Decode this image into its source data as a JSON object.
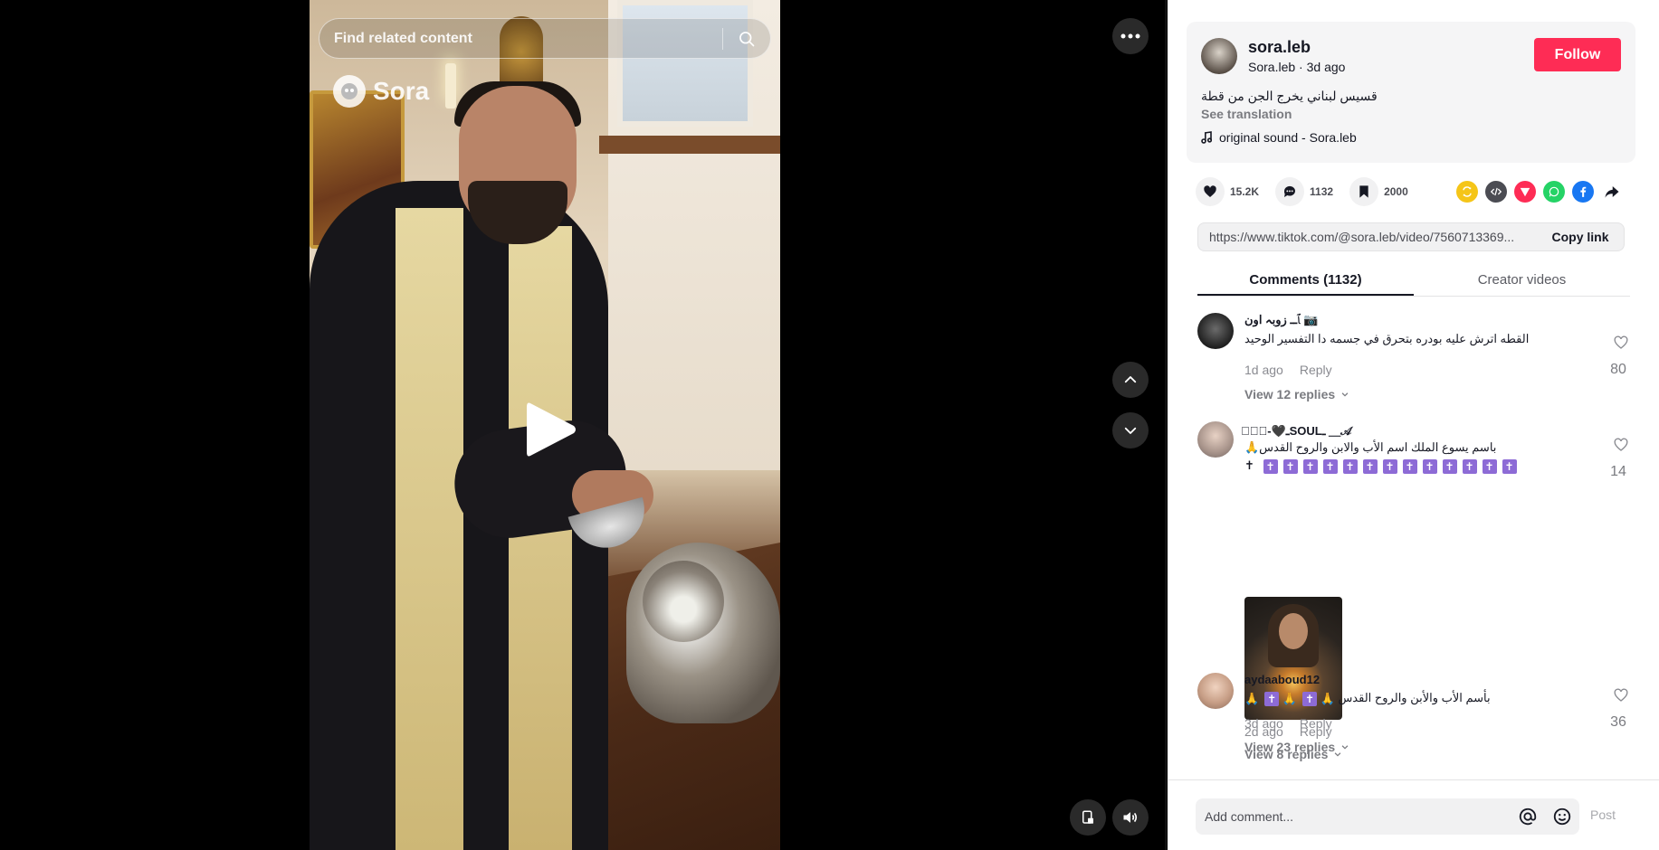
{
  "search": {
    "placeholder": "Find related content"
  },
  "watermark": {
    "text": "Sora"
  },
  "author": {
    "username": "sora.leb",
    "display_name": "Sora.leb",
    "time_ago": "3d ago",
    "follow_label": "Follow"
  },
  "post": {
    "caption": "قسيس لبناني يخرج الجن من قطة",
    "see_translation": "See translation",
    "sound": "original sound - Sora.leb"
  },
  "stats": {
    "likes": "15.2K",
    "comments": "1132",
    "saves": "2000"
  },
  "share_icons": [
    "repost-icon",
    "embed-icon",
    "send-icon",
    "whatsapp-icon",
    "facebook-icon",
    "share-arrow-icon"
  ],
  "link": {
    "url": "https://www.tiktok.com/@sora.leb/video/7560713369...",
    "copy_label": "Copy link"
  },
  "tabs": [
    {
      "label": "Comments (1132)",
      "active": true
    },
    {
      "label": "Creator videos",
      "active": false
    }
  ],
  "comments": [
    {
      "name": "ﭑــ زوبہ اون 📷",
      "text": "القطه اترش عليه بودره بتحرق في جسمه دا التفسير الوحيد",
      "time": "1d ago",
      "reply": "Reply",
      "likes": "80",
      "view_replies": "View 12 replies"
    },
    {
      "name": "͏𝚇𝚇꙰-🖤ـSOULـ ＿𝒜",
      "text": "باسم يسوع الملك اسم الأب والابن والروح القدس🙏",
      "text2": "✝",
      "cross_count": 13,
      "time": "2d ago",
      "reply": "Reply",
      "likes": "14",
      "view_replies": "View 8 replies"
    },
    {
      "name": "aydaaboud12",
      "text": "بأسم الأب والأبن والروح القدس",
      "time": "3d ago",
      "reply": "Reply",
      "likes": "36",
      "view_replies": "View 23 replies"
    }
  ],
  "add_comment": {
    "placeholder": "Add comment...",
    "post_label": "Post"
  },
  "colors": {
    "accent": "#fe2c55",
    "text": "#161823",
    "muted": "#8a8b91"
  }
}
